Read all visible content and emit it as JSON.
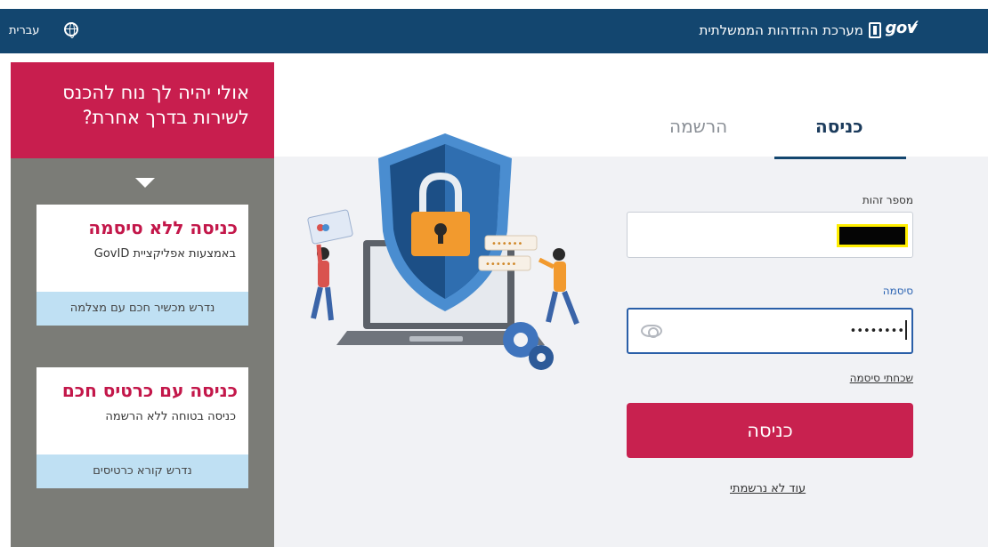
{
  "topbar": {
    "system_title": "מערכת ההזדהות הממשלתית",
    "logo_text": "gov",
    "language_label": "עברית"
  },
  "side_panel": {
    "header_text": "אולי יהיה לך נוח להכנס לשירות בדרך אחרת?",
    "cards": [
      {
        "title": "כניסה ללא סיסמה",
        "subtitle": "באמצעות אפליקציית GovID",
        "footer": "נדרש מכשיר חכם עם מצלמה"
      },
      {
        "title": "כניסה עם כרטיס חכם",
        "subtitle": "כניסה בטוחה ללא הרשמה",
        "footer": "נדרש קורא כרטיסים"
      }
    ]
  },
  "tabs": {
    "login": "כניסה",
    "register": "הרשמה"
  },
  "form": {
    "id_label": "מספר זהות",
    "password_label": "סיסמה",
    "password_value": "••••••••",
    "forgot_password": "שכחתי סיסמה",
    "submit_label": "כניסה",
    "not_registered": "עוד לא נרשמתי"
  },
  "colors": {
    "topbar": "#13466f",
    "accent": "#c8214f",
    "side_panel": "#7b7c77",
    "card_footer": "#bfe0f3",
    "main_background": "#f1f2f5"
  }
}
